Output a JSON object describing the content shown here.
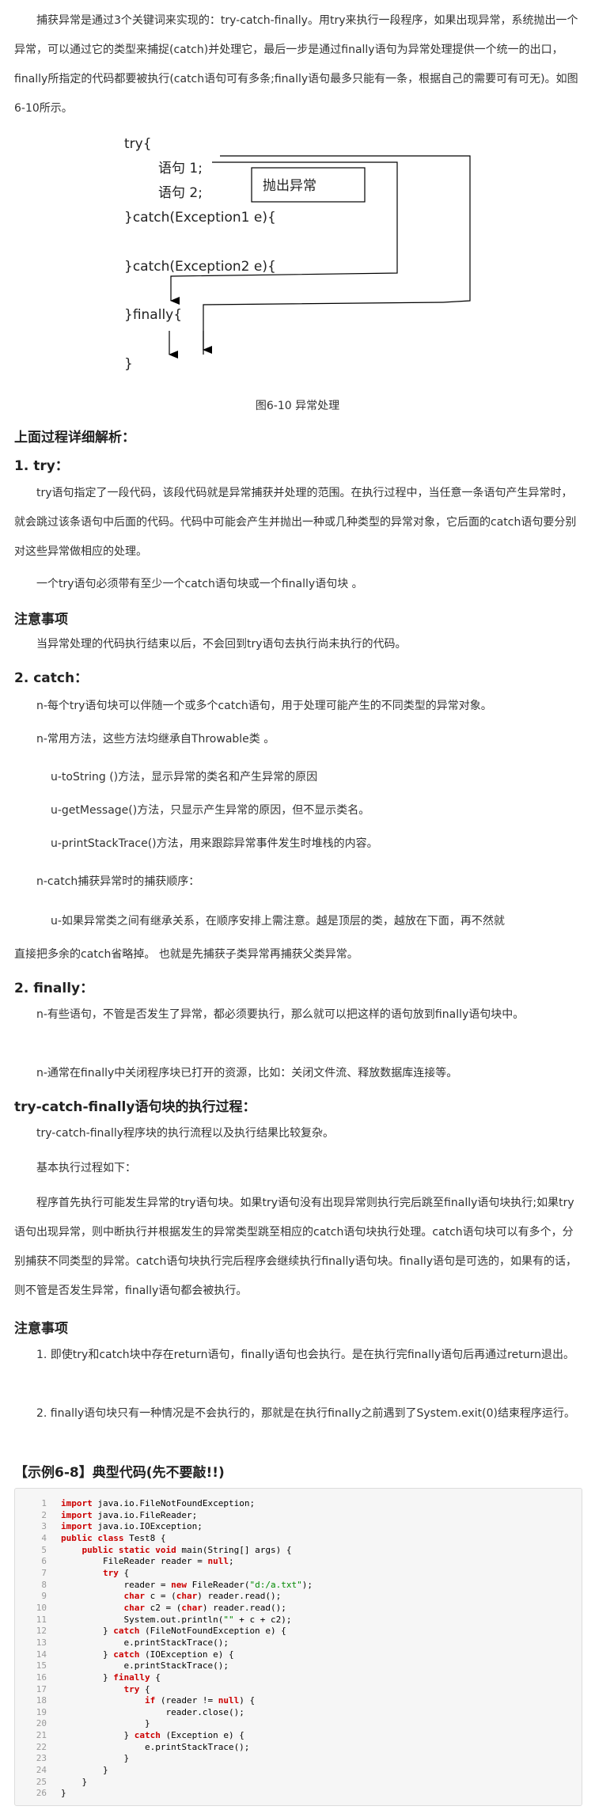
{
  "intro": "捕获异常是通过3个关键词来实现的：try-catch-finally。用try来执行一段程序，如果出现异常，系统抛出一个异常，可以通过它的类型来捕捉(catch)并处理它，最后一步是通过finally语句为异常处理提供一个统一的出口，finally所指定的代码都要被执行(catch语句可有多条;finally语句最多只能有一条，根据自己的需要可有可无)。如图6-10所示。",
  "diagram": {
    "try_open": "try{",
    "stmt1": "语句 1;",
    "stmt2": "语句 2;",
    "throw_box": "抛出异常",
    "catch1": "}catch(Exception1 e){",
    "catch2": "}catch(Exception2 e){",
    "finally": "}finally{",
    "close": "}",
    "caption": "图6-10 异常处理"
  },
  "sec_analysis": "上面过程详细解析：",
  "sec_try": "1. try：",
  "try_p1": "try语句指定了一段代码，该段代码就是异常捕获并处理的范围。在执行过程中，当任意一条语句产生异常时，就会跳过该条语句中后面的代码。代码中可能会产生并抛出一种或几种类型的异常对象，它后面的catch语句要分别对这些异常做相应的处理。",
  "try_p2": "一个try语句必须带有至少一个catch语句块或一个finally语句块 。",
  "note1_title": "注意事项",
  "note1_text": "当异常处理的代码执行结束以后，不会回到try语句去执行尚未执行的代码。",
  "sec_catch": "2. catch：",
  "catch_p1": "n-每个try语句块可以伴随一个或多个catch语句，用于处理可能产生的不同类型的异常对象。",
  "catch_p2": "n-常用方法，这些方法均继承自Throwable类 。",
  "catch_u1": "u-toString ()方法，显示异常的类名和产生异常的原因",
  "catch_u2": "u-getMessage()方法，只显示产生异常的原因，但不显示类名。",
  "catch_u3": "u-printStackTrace()方法，用来跟踪异常事件发生时堆栈的内容。",
  "catch_p3": "n-catch捕获异常时的捕获顺序：",
  "catch_u4a": "u-如果异常类之间有继承关系，在顺序安排上需注意。越是顶层的类，越放在下面，再不然就",
  "catch_u4b": "直接把多余的catch省略掉。 也就是先捕获子类异常再捕获父类异常。",
  "sec_finally": "2. finally：",
  "finally_p1": "n-有些语句，不管是否发生了异常，都必须要执行，那么就可以把这样的语句放到finally语句块中。",
  "finally_p2": "n-通常在finally中关闭程序块已打开的资源，比如：关闭文件流、释放数据库连接等。",
  "sec_flow": "try-catch-finally语句块的执行过程：",
  "flow_p1": "try-catch-finally程序块的执行流程以及执行结果比较复杂。",
  "flow_p2": "基本执行过程如下：",
  "flow_p3": "程序首先执行可能发生异常的try语句块。如果try语句没有出现异常则执行完后跳至finally语句块执行;如果try语句出现异常，则中断执行并根据发生的异常类型跳至相应的catch语句块执行处理。catch语句块可以有多个，分别捕获不同类型的异常。catch语句块执行完后程序会继续执行finally语句块。finally语句是可选的，如果有的话，则不管是否发生异常，finally语句都会被执行。",
  "note2_title": "注意事项",
  "note2_1": "1. 即使try和catch块中存在return语句，finally语句也会执行。是在执行完finally语句后再通过return退出。",
  "note2_2": "2. finally语句块只有一种情况是不会执行的，那就是在执行finally之前遇到了System.exit(0)结束程序运行。",
  "example_title": "【示例6-8】典型代码(先不要敲!!)",
  "code": {
    "line_numbers": [
      "1",
      "2",
      "3",
      "4",
      "5",
      "6",
      "7",
      "8",
      "9",
      "10",
      "11",
      "12",
      "13",
      "14",
      "15",
      "16",
      "17",
      "18",
      "19",
      "20",
      "21",
      "22",
      "23",
      "24",
      "25",
      "26"
    ],
    "lines": [
      "import java.io.FileNotFoundException;",
      "import java.io.FileReader;",
      "import java.io.IOException;",
      "public class Test8 {",
      "    public static void main(String[] args) {",
      "        FileReader reader = null;",
      "        try {",
      "            reader = new FileReader(\"d:/a.txt\");",
      "            char c = (char) reader.read();",
      "            char c2 = (char) reader.read();",
      "            System.out.println(\"\" + c + c2);",
      "        } catch (FileNotFoundException e) {",
      "            e.printStackTrace();",
      "        } catch (IOException e) {",
      "            e.printStackTrace();",
      "        } finally {",
      "            try {",
      "                if (reader != null) {",
      "                    reader.close();",
      "                }",
      "            } catch (Exception e) {",
      "                e.printStackTrace();",
      "            }",
      "        }",
      "    }",
      "}"
    ],
    "keywords": [
      "import",
      "public",
      "class",
      "static",
      "void",
      "null",
      "try",
      "new",
      "char",
      "catch",
      "finally",
      "if"
    ]
  }
}
